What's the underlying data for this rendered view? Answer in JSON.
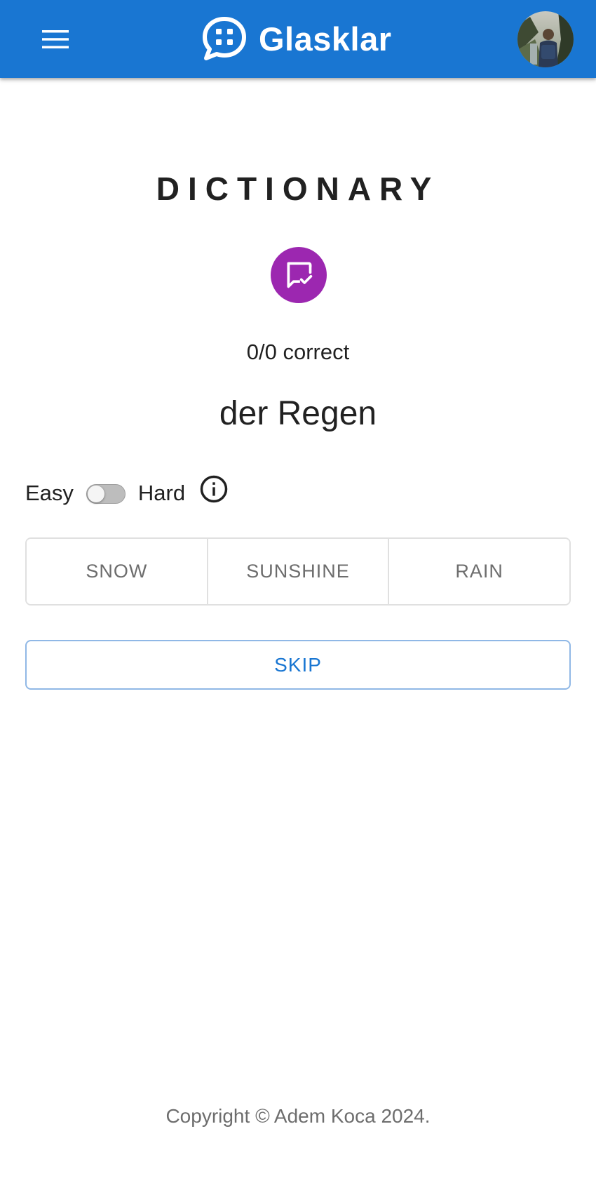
{
  "header": {
    "brand": "Glasklar",
    "menu_icon": "hamburger-menu-icon",
    "avatar": "user-avatar-photo",
    "bar_color": "#1976d2"
  },
  "main": {
    "title": "DICTIONARY",
    "badge_icon": "chat-check-icon",
    "badge_color": "#9c27b0",
    "score_text": "0/0 correct",
    "prompt_word": "der Regen",
    "difficulty": {
      "easy_label": "Easy",
      "hard_label": "Hard",
      "hard_enabled": false,
      "info_icon": "info-circle-icon"
    },
    "options": [
      "SNOW",
      "SUNSHINE",
      "RAIN"
    ],
    "skip_label": "SKIP"
  },
  "footer": {
    "copyright": "Copyright © Adem Koca 2024."
  }
}
